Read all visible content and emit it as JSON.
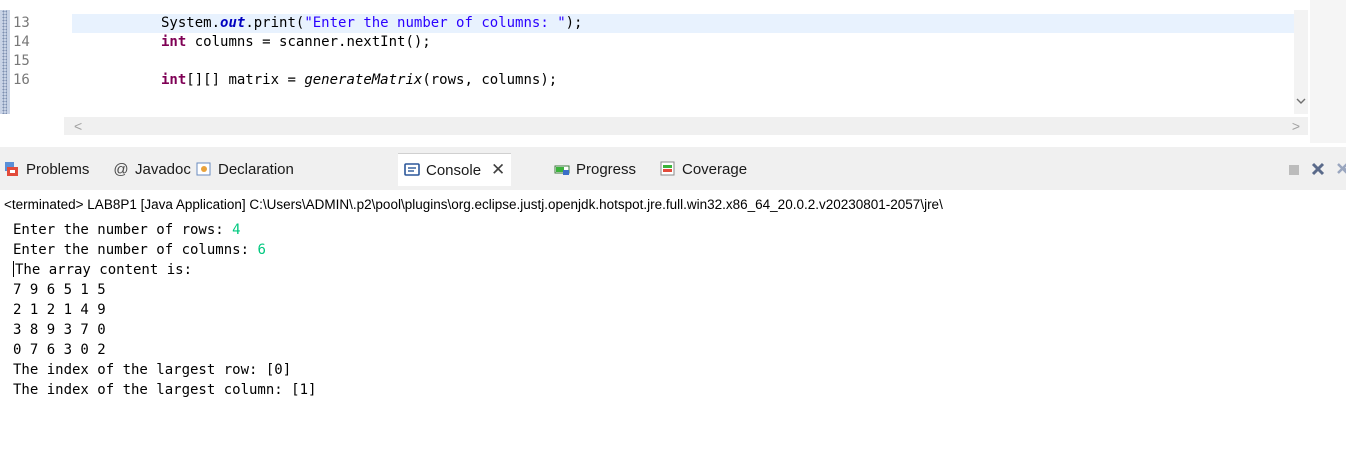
{
  "editor": {
    "lines": [
      {
        "no": "13",
        "indent": "",
        "p1": "System.",
        "field": "out",
        "p2": ".print(",
        "str": "\"Enter the number of columns: \"",
        "p3": ");",
        "current": true
      },
      {
        "no": "14",
        "kw": "int",
        "rest": " columns = scanner.nextInt();"
      },
      {
        "no": "15"
      },
      {
        "no": "16",
        "kw": "int",
        "rest1": "[][] matrix = ",
        "meth": "generateMatrix",
        "rest2": "(rows, columns);"
      }
    ],
    "hscroll": {
      "left": "<",
      "right": ">"
    },
    "vscroll_arrow": "v"
  },
  "views": {
    "tabs": [
      {
        "label": "Problems",
        "icon": "problems-icon"
      },
      {
        "label": "Javadoc",
        "icon": "javadoc-at-icon",
        "glyph": "@"
      },
      {
        "label": "Declaration",
        "icon": "declaration-icon"
      },
      {
        "label": "Console",
        "icon": "console-icon",
        "active": true
      },
      {
        "label": "Progress",
        "icon": "progress-icon"
      },
      {
        "label": "Coverage",
        "icon": "coverage-icon"
      }
    ],
    "close_glyph": "✕"
  },
  "console": {
    "terminated": "<terminated> LAB8P1 [Java Application] C:\\Users\\ADMIN\\.p2\\pool\\plugins\\org.eclipse.justj.openjdk.hotspot.jre.full.win32.x86_64_20.0.2.v20230801-2057\\jre\\",
    "output": [
      {
        "text": "Enter the number of rows: ",
        "input": "4"
      },
      {
        "text": "Enter the number of columns: ",
        "input": "6"
      },
      {
        "text": "The array content is:",
        "caret": true
      },
      {
        "text": "7 9 6 5 1 5"
      },
      {
        "text": "2 1 2 1 4 9"
      },
      {
        "text": "3 8 9 3 7 0"
      },
      {
        "text": "0 7 6 3 0 2"
      },
      {
        "text": "The index of the largest row: [0]"
      },
      {
        "text": "The index of the largest column: [1]"
      }
    ]
  },
  "colors": {
    "keyword": "#7f0055",
    "string": "#2a00ff",
    "field": "#0000c0",
    "user_input": "#00c87f"
  }
}
